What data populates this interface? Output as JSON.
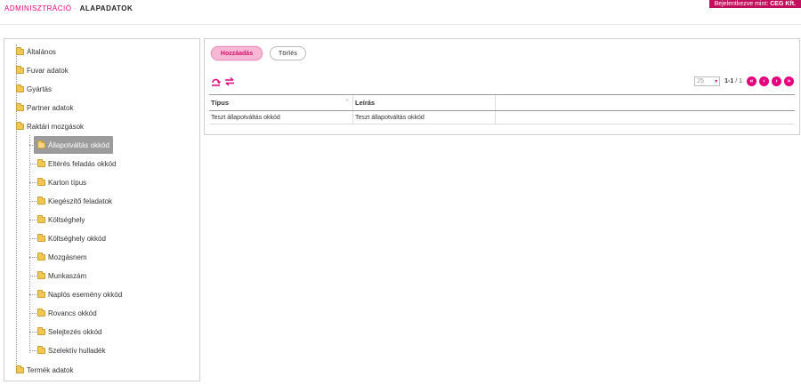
{
  "header": {
    "breadcrumb_root": "ADMINISZTRÁCIÓ",
    "breadcrumb_sep": "·",
    "breadcrumb_current": "ALAPADATOK",
    "login_prefix": "Bejelentkezve mint:",
    "login_user": "CEG Kft."
  },
  "tree": {
    "items": [
      {
        "label": "Általános"
      },
      {
        "label": "Fuvar adatok"
      },
      {
        "label": "Gyártás"
      },
      {
        "label": "Partner adatok"
      },
      {
        "label": "Raktári mozgások"
      },
      {
        "label": "Állapotváltás okkód"
      },
      {
        "label": "Eltérés feladás okkód"
      },
      {
        "label": "Karton típus"
      },
      {
        "label": "Kiegészítő feladatok"
      },
      {
        "label": "Költséghely"
      },
      {
        "label": "Költséghely okkód"
      },
      {
        "label": "Mozgásnem"
      },
      {
        "label": "Munkaszám"
      },
      {
        "label": "Naplós esemény okkód"
      },
      {
        "label": "Rovancs okkód"
      },
      {
        "label": "Selejtezés okkód"
      },
      {
        "label": "Szelektív hulladék"
      },
      {
        "label": "Termék adatok"
      }
    ]
  },
  "toolbar": {
    "add_label": "Hozzáadás",
    "delete_label": "Törlés"
  },
  "pager": {
    "page_size": "25",
    "range": "1-1",
    "total": "/ 1"
  },
  "grid": {
    "columns": [
      "Típus",
      "Leírás"
    ],
    "rows": [
      [
        "Teszt állapotváltás okkód",
        "Teszt állapotváltás okkód"
      ]
    ]
  },
  "colors": {
    "accent": "#e4007d",
    "badge": "#c2105e"
  }
}
